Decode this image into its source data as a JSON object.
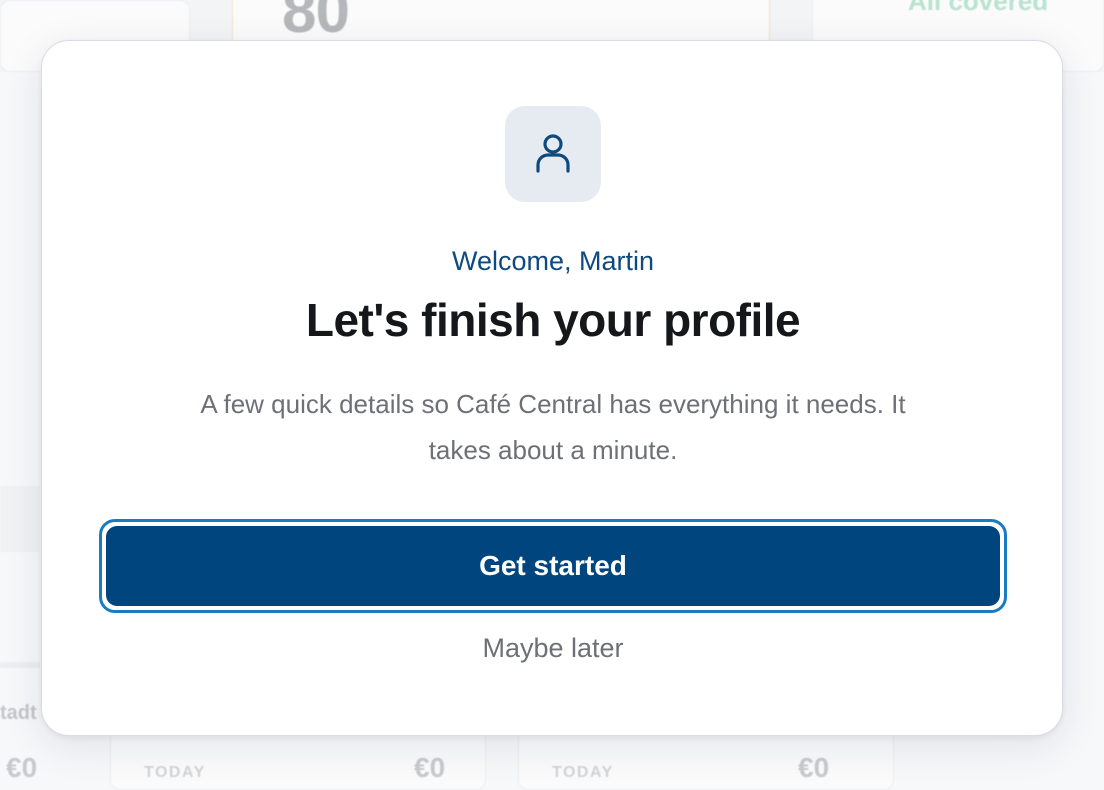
{
  "background": {
    "stat_value": "80",
    "status_text": "All covered",
    "side_label": "tadt",
    "amounts": [
      "€0",
      "€0",
      "€0"
    ],
    "period_labels": [
      "TODAY",
      "TODAY"
    ]
  },
  "modal": {
    "icon": "user-icon",
    "greeting": "Welcome, Martin",
    "title": "Let's finish your profile",
    "description": "A few quick details so Café Central has everything it needs. It takes about a minute.",
    "primary_action": "Get started",
    "secondary_action": "Maybe later"
  },
  "colors": {
    "brand_primary": "#00457d",
    "focus_ring": "#1b7bc0",
    "greeting": "#0f4a7e",
    "icon_tile": "#e6ebf1"
  }
}
